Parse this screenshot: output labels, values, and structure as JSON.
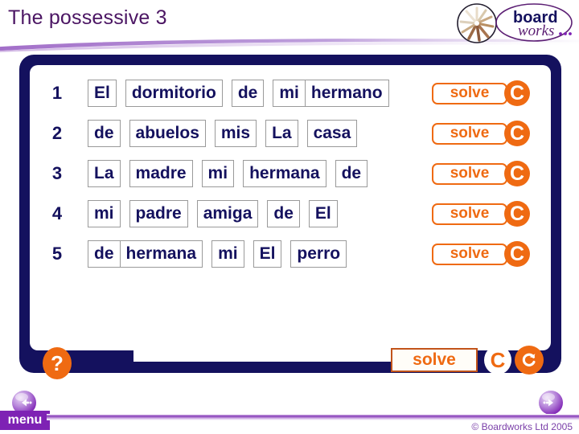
{
  "header": {
    "title": "The possessive 3",
    "logo": {
      "word_top": "board",
      "word_bottom": "works",
      "starburst_icon": "starburst-icon"
    }
  },
  "activity": {
    "rows": [
      {
        "number": "1",
        "groups": [
          {
            "words": [
              "El"
            ]
          },
          {
            "words": [
              "dormitorio"
            ]
          },
          {
            "words": [
              "de"
            ]
          },
          {
            "words": [
              "mi",
              "hermano"
            ]
          }
        ],
        "solve_label": "solve",
        "check_label": "C"
      },
      {
        "number": "2",
        "groups": [
          {
            "words": [
              "de"
            ]
          },
          {
            "words": [
              "abuelos"
            ]
          },
          {
            "words": [
              "mis"
            ]
          },
          {
            "words": [
              "La"
            ]
          },
          {
            "words": [
              "casa"
            ]
          }
        ],
        "solve_label": "solve",
        "check_label": "C"
      },
      {
        "number": "3",
        "groups": [
          {
            "words": [
              "La"
            ]
          },
          {
            "words": [
              "madre"
            ]
          },
          {
            "words": [
              "mi"
            ]
          },
          {
            "words": [
              "hermana"
            ]
          },
          {
            "words": [
              "de"
            ]
          }
        ],
        "solve_label": "solve",
        "check_label": "C"
      },
      {
        "number": "4",
        "groups": [
          {
            "words": [
              "mi"
            ]
          },
          {
            "words": [
              "padre"
            ]
          },
          {
            "words": [
              "amiga"
            ]
          },
          {
            "words": [
              "de"
            ]
          },
          {
            "words": [
              "El"
            ]
          }
        ],
        "solve_label": "solve",
        "check_label": "C"
      },
      {
        "number": "5",
        "groups": [
          {
            "words": [
              "de",
              "hermana"
            ]
          },
          {
            "words": [
              "mi"
            ]
          },
          {
            "words": [
              "El"
            ]
          },
          {
            "words": [
              "perro"
            ]
          }
        ],
        "solve_label": "solve",
        "check_label": "C"
      }
    ],
    "toolbar": {
      "help_label": "?",
      "solve_label": "solve",
      "check_label": "C",
      "reset_icon": "undo-arrow-icon"
    }
  },
  "footer": {
    "menu_label": "menu",
    "prev_icon": "previous-arrow-icon",
    "next_icon": "next-arrow-icon",
    "copyright": "© Boardworks Ltd 2005"
  },
  "colors": {
    "title_purple": "#4b1563",
    "frame_navy": "#14115e",
    "accent_orange": "#ef6a12",
    "menu_purple": "#7e22b4",
    "word_navy": "#14115e"
  }
}
